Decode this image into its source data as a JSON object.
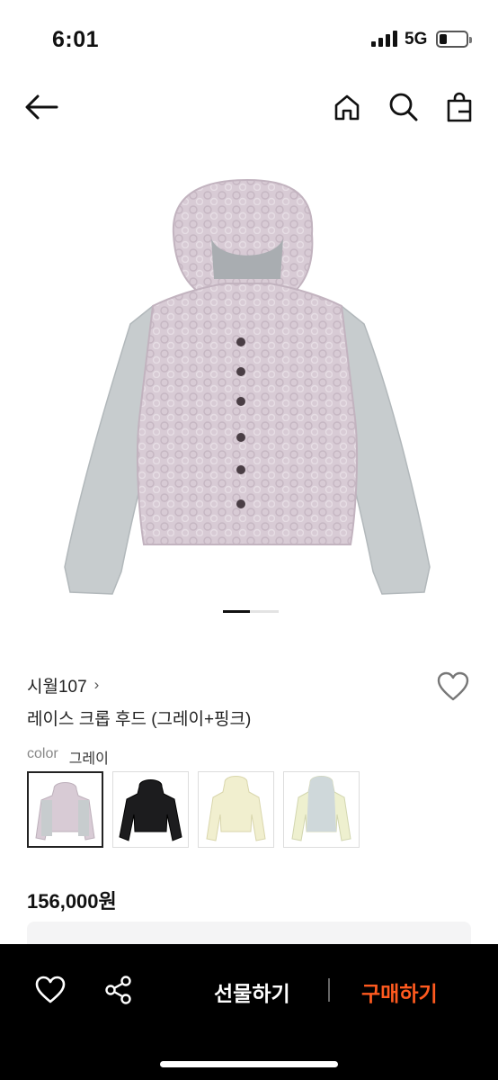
{
  "status_bar": {
    "time": "6:01",
    "network": "5G"
  },
  "nav": {
    "icons": [
      "back-arrow-icon",
      "home-icon",
      "search-icon",
      "shopping-bag-icon"
    ]
  },
  "product": {
    "brand": "시월107",
    "brand_chevron": "›",
    "title": "레이스 크롭 후드 (그레이+핑크)",
    "color_label": "color",
    "color_value": "그레이",
    "price": "156,000원",
    "thumbnails": [
      "gray-pink",
      "black",
      "cream-yellow",
      "cream-mint"
    ],
    "selected_thumbnail": 0
  },
  "bottom_bar": {
    "gift_label": "선물하기",
    "buy_label": "구매하기"
  },
  "colors": {
    "accent": "#ff5a1f",
    "jacket_body": "#d9ccd6",
    "jacket_sleeve": "#c4c9cc"
  }
}
